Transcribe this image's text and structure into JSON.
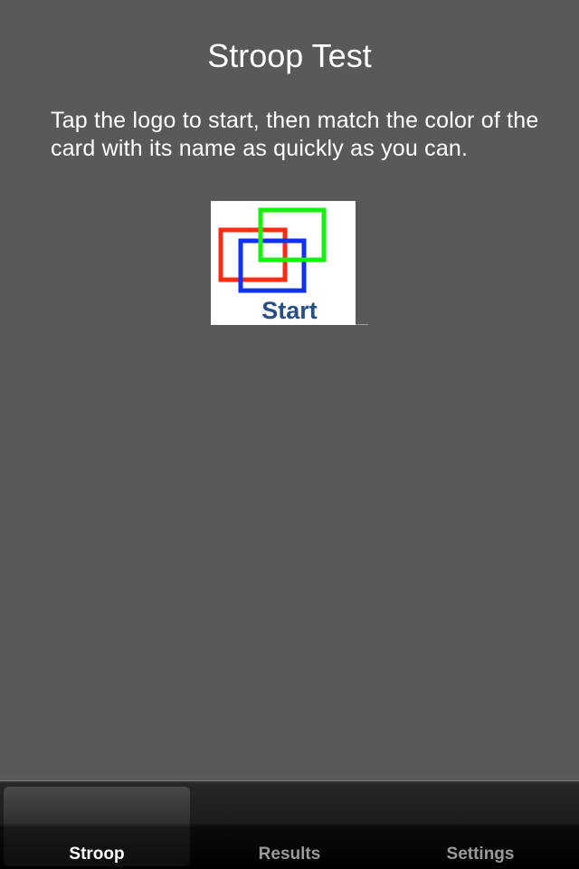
{
  "header": {
    "title": "Stroop Test"
  },
  "main": {
    "instructions": "Tap the logo to start, then match the color of the card with its name as quickly as you can.",
    "logo": {
      "label": "Start",
      "colors": {
        "red": "#ff2a12",
        "green": "#16f20e",
        "blue": "#1131f2",
        "text": "#274f86"
      }
    }
  },
  "tabbar": {
    "tabs": [
      {
        "label": "Stroop",
        "selected": true
      },
      {
        "label": "Results",
        "selected": false
      },
      {
        "label": "Settings",
        "selected": false
      }
    ]
  },
  "theme": {
    "background": "#595959",
    "text": "#ffffff",
    "tab_inactive": "#9a9a9a"
  }
}
